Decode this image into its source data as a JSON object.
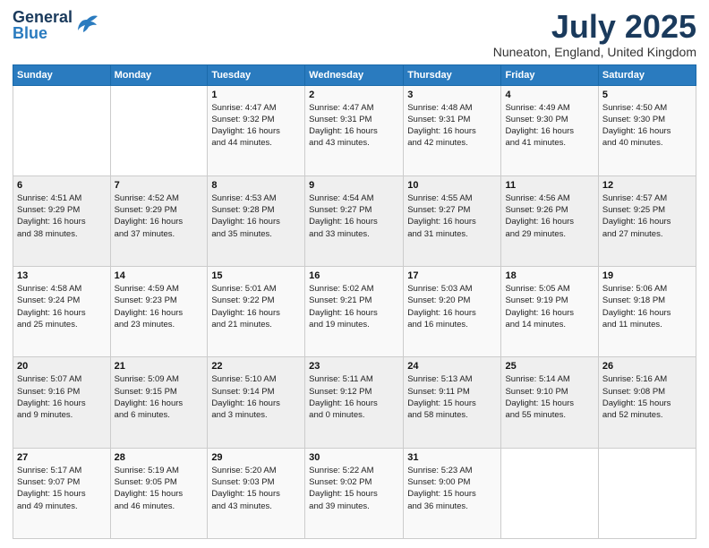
{
  "logo": {
    "line1": "General",
    "line2": "Blue"
  },
  "header": {
    "title": "July 2025",
    "subtitle": "Nuneaton, England, United Kingdom"
  },
  "weekdays": [
    "Sunday",
    "Monday",
    "Tuesday",
    "Wednesday",
    "Thursday",
    "Friday",
    "Saturday"
  ],
  "weeks": [
    [
      {
        "day": "",
        "info": ""
      },
      {
        "day": "",
        "info": ""
      },
      {
        "day": "1",
        "info": "Sunrise: 4:47 AM\nSunset: 9:32 PM\nDaylight: 16 hours\nand 44 minutes."
      },
      {
        "day": "2",
        "info": "Sunrise: 4:47 AM\nSunset: 9:31 PM\nDaylight: 16 hours\nand 43 minutes."
      },
      {
        "day": "3",
        "info": "Sunrise: 4:48 AM\nSunset: 9:31 PM\nDaylight: 16 hours\nand 42 minutes."
      },
      {
        "day": "4",
        "info": "Sunrise: 4:49 AM\nSunset: 9:30 PM\nDaylight: 16 hours\nand 41 minutes."
      },
      {
        "day": "5",
        "info": "Sunrise: 4:50 AM\nSunset: 9:30 PM\nDaylight: 16 hours\nand 40 minutes."
      }
    ],
    [
      {
        "day": "6",
        "info": "Sunrise: 4:51 AM\nSunset: 9:29 PM\nDaylight: 16 hours\nand 38 minutes."
      },
      {
        "day": "7",
        "info": "Sunrise: 4:52 AM\nSunset: 9:29 PM\nDaylight: 16 hours\nand 37 minutes."
      },
      {
        "day": "8",
        "info": "Sunrise: 4:53 AM\nSunset: 9:28 PM\nDaylight: 16 hours\nand 35 minutes."
      },
      {
        "day": "9",
        "info": "Sunrise: 4:54 AM\nSunset: 9:27 PM\nDaylight: 16 hours\nand 33 minutes."
      },
      {
        "day": "10",
        "info": "Sunrise: 4:55 AM\nSunset: 9:27 PM\nDaylight: 16 hours\nand 31 minutes."
      },
      {
        "day": "11",
        "info": "Sunrise: 4:56 AM\nSunset: 9:26 PM\nDaylight: 16 hours\nand 29 minutes."
      },
      {
        "day": "12",
        "info": "Sunrise: 4:57 AM\nSunset: 9:25 PM\nDaylight: 16 hours\nand 27 minutes."
      }
    ],
    [
      {
        "day": "13",
        "info": "Sunrise: 4:58 AM\nSunset: 9:24 PM\nDaylight: 16 hours\nand 25 minutes."
      },
      {
        "day": "14",
        "info": "Sunrise: 4:59 AM\nSunset: 9:23 PM\nDaylight: 16 hours\nand 23 minutes."
      },
      {
        "day": "15",
        "info": "Sunrise: 5:01 AM\nSunset: 9:22 PM\nDaylight: 16 hours\nand 21 minutes."
      },
      {
        "day": "16",
        "info": "Sunrise: 5:02 AM\nSunset: 9:21 PM\nDaylight: 16 hours\nand 19 minutes."
      },
      {
        "day": "17",
        "info": "Sunrise: 5:03 AM\nSunset: 9:20 PM\nDaylight: 16 hours\nand 16 minutes."
      },
      {
        "day": "18",
        "info": "Sunrise: 5:05 AM\nSunset: 9:19 PM\nDaylight: 16 hours\nand 14 minutes."
      },
      {
        "day": "19",
        "info": "Sunrise: 5:06 AM\nSunset: 9:18 PM\nDaylight: 16 hours\nand 11 minutes."
      }
    ],
    [
      {
        "day": "20",
        "info": "Sunrise: 5:07 AM\nSunset: 9:16 PM\nDaylight: 16 hours\nand 9 minutes."
      },
      {
        "day": "21",
        "info": "Sunrise: 5:09 AM\nSunset: 9:15 PM\nDaylight: 16 hours\nand 6 minutes."
      },
      {
        "day": "22",
        "info": "Sunrise: 5:10 AM\nSunset: 9:14 PM\nDaylight: 16 hours\nand 3 minutes."
      },
      {
        "day": "23",
        "info": "Sunrise: 5:11 AM\nSunset: 9:12 PM\nDaylight: 16 hours\nand 0 minutes."
      },
      {
        "day": "24",
        "info": "Sunrise: 5:13 AM\nSunset: 9:11 PM\nDaylight: 15 hours\nand 58 minutes."
      },
      {
        "day": "25",
        "info": "Sunrise: 5:14 AM\nSunset: 9:10 PM\nDaylight: 15 hours\nand 55 minutes."
      },
      {
        "day": "26",
        "info": "Sunrise: 5:16 AM\nSunset: 9:08 PM\nDaylight: 15 hours\nand 52 minutes."
      }
    ],
    [
      {
        "day": "27",
        "info": "Sunrise: 5:17 AM\nSunset: 9:07 PM\nDaylight: 15 hours\nand 49 minutes."
      },
      {
        "day": "28",
        "info": "Sunrise: 5:19 AM\nSunset: 9:05 PM\nDaylight: 15 hours\nand 46 minutes."
      },
      {
        "day": "29",
        "info": "Sunrise: 5:20 AM\nSunset: 9:03 PM\nDaylight: 15 hours\nand 43 minutes."
      },
      {
        "day": "30",
        "info": "Sunrise: 5:22 AM\nSunset: 9:02 PM\nDaylight: 15 hours\nand 39 minutes."
      },
      {
        "day": "31",
        "info": "Sunrise: 5:23 AM\nSunset: 9:00 PM\nDaylight: 15 hours\nand 36 minutes."
      },
      {
        "day": "",
        "info": ""
      },
      {
        "day": "",
        "info": ""
      }
    ]
  ]
}
